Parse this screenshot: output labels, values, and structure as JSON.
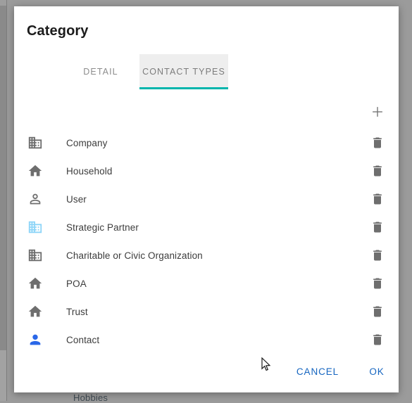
{
  "backdrop": {
    "behind_text": "Hobbies",
    "color": "#9b9b9b"
  },
  "dialog": {
    "title": "Category",
    "accent_color": "#00b5ad",
    "action_color": "#1565c0"
  },
  "tabs": [
    {
      "label": "DETAIL",
      "active": false,
      "name": "tab-detail"
    },
    {
      "label": "CONTACT TYPES",
      "active": true,
      "name": "tab-contact-types"
    }
  ],
  "toolbar": {
    "add_icon": "plus-icon",
    "add_label": "+"
  },
  "list": {
    "delete_icon": "trash-icon",
    "rows": [
      {
        "label": "Company",
        "icon": "business-icon",
        "icon_color": "#6e6e6e"
      },
      {
        "label": "Household",
        "icon": "home-icon",
        "icon_color": "#6e6e6e"
      },
      {
        "label": "User",
        "icon": "person-outline-icon",
        "icon_color": "#6e6e6e"
      },
      {
        "label": "Strategic Partner",
        "icon": "business-icon",
        "icon_color": "#8ed5f8"
      },
      {
        "label": "Charitable or Civic Organization",
        "icon": "business-icon",
        "icon_color": "#6e6e6e"
      },
      {
        "label": "POA",
        "icon": "home-icon",
        "icon_color": "#6e6e6e"
      },
      {
        "label": "Trust",
        "icon": "home-icon",
        "icon_color": "#6e6e6e"
      },
      {
        "label": "Contact",
        "icon": "person-filled-icon",
        "icon_color": "#2a67e8"
      }
    ]
  },
  "footer": {
    "cancel_label": "CANCEL",
    "ok_label": "OK"
  },
  "cursor": {
    "icon": "mouse-pointer-icon"
  }
}
